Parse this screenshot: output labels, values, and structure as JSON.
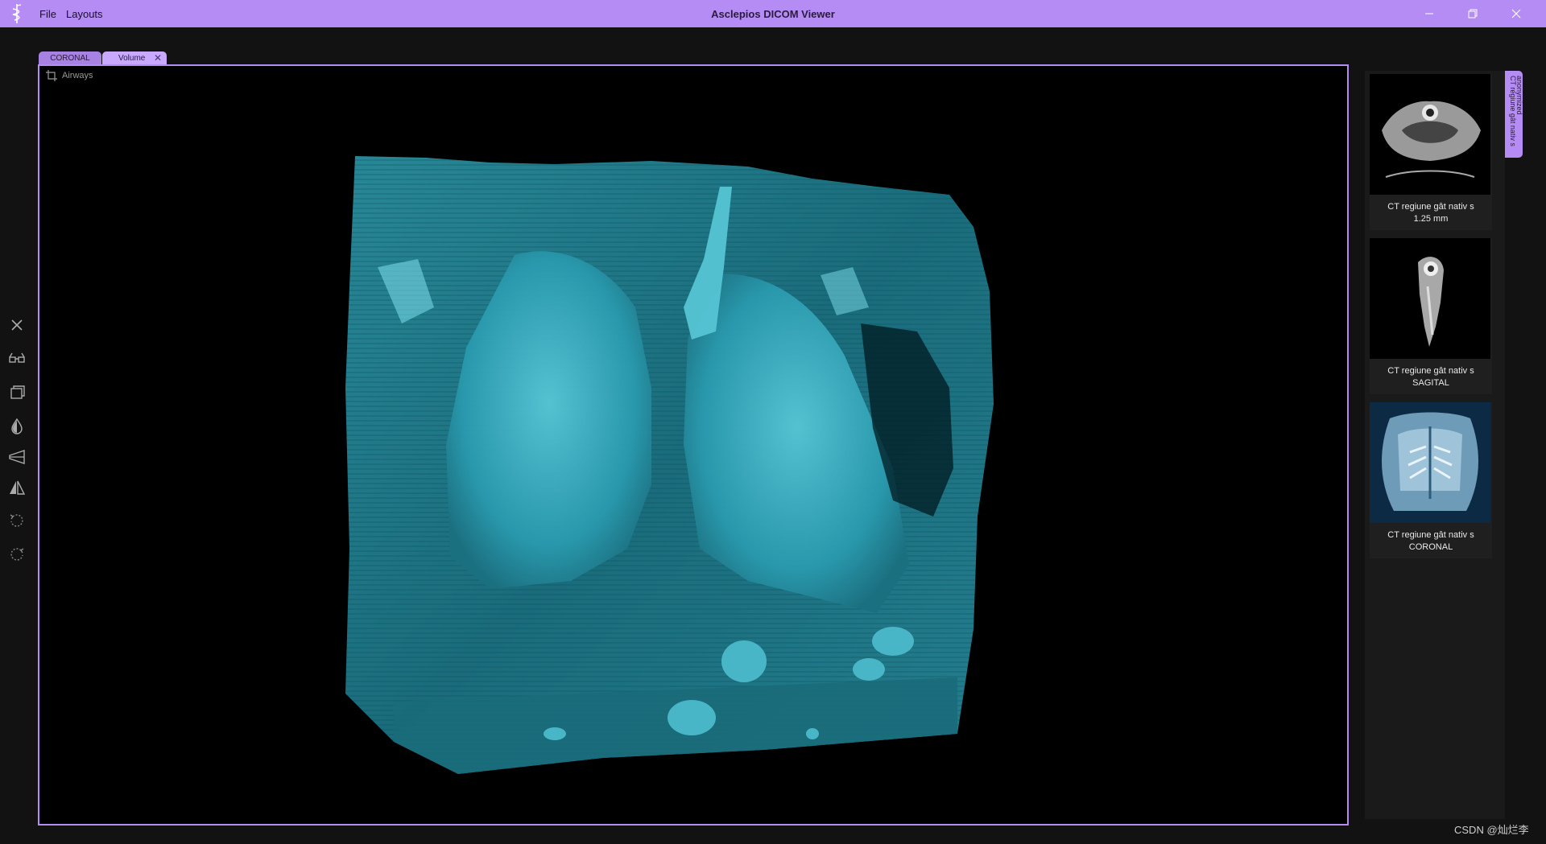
{
  "app": {
    "title": "Asclepios DICOM Viewer",
    "menu": [
      "File",
      "Layouts"
    ]
  },
  "window_controls": {
    "minimize_icon": "minimize-icon",
    "maximize_icon": "restore-icon",
    "close_icon": "close-icon"
  },
  "tabs": [
    {
      "label": "CORONAL"
    },
    {
      "label": "Volume",
      "close": "✕"
    }
  ],
  "viewport": {
    "label": "Airways",
    "render_color": "#3aa5b5",
    "border_color": "#b58cf4"
  },
  "toolbar": {
    "items": [
      "close-icon",
      "glasses-icon",
      "window-copy-icon",
      "drop-icon",
      "bullhorn-icon",
      "flip-icon",
      "rotate-left-icon",
      "rotate-right-icon"
    ]
  },
  "series": [
    {
      "caption_line1": "CT regiune gât nativ s",
      "caption_line2": "1.25 mm"
    },
    {
      "caption_line1": "CT regiune gât nativ s",
      "caption_line2": "SAGITAL"
    },
    {
      "caption_line1": "CT regiune gât nativ s",
      "caption_line2": "CORONAL"
    }
  ],
  "patient_tab": {
    "line1": "anonymized",
    "line2": "CT regiune gât nativ s"
  },
  "watermark": "CSDN @灿烂李",
  "colors": {
    "accent": "#b58cf4",
    "background": "#121212",
    "volume": "#3aa5b5"
  }
}
